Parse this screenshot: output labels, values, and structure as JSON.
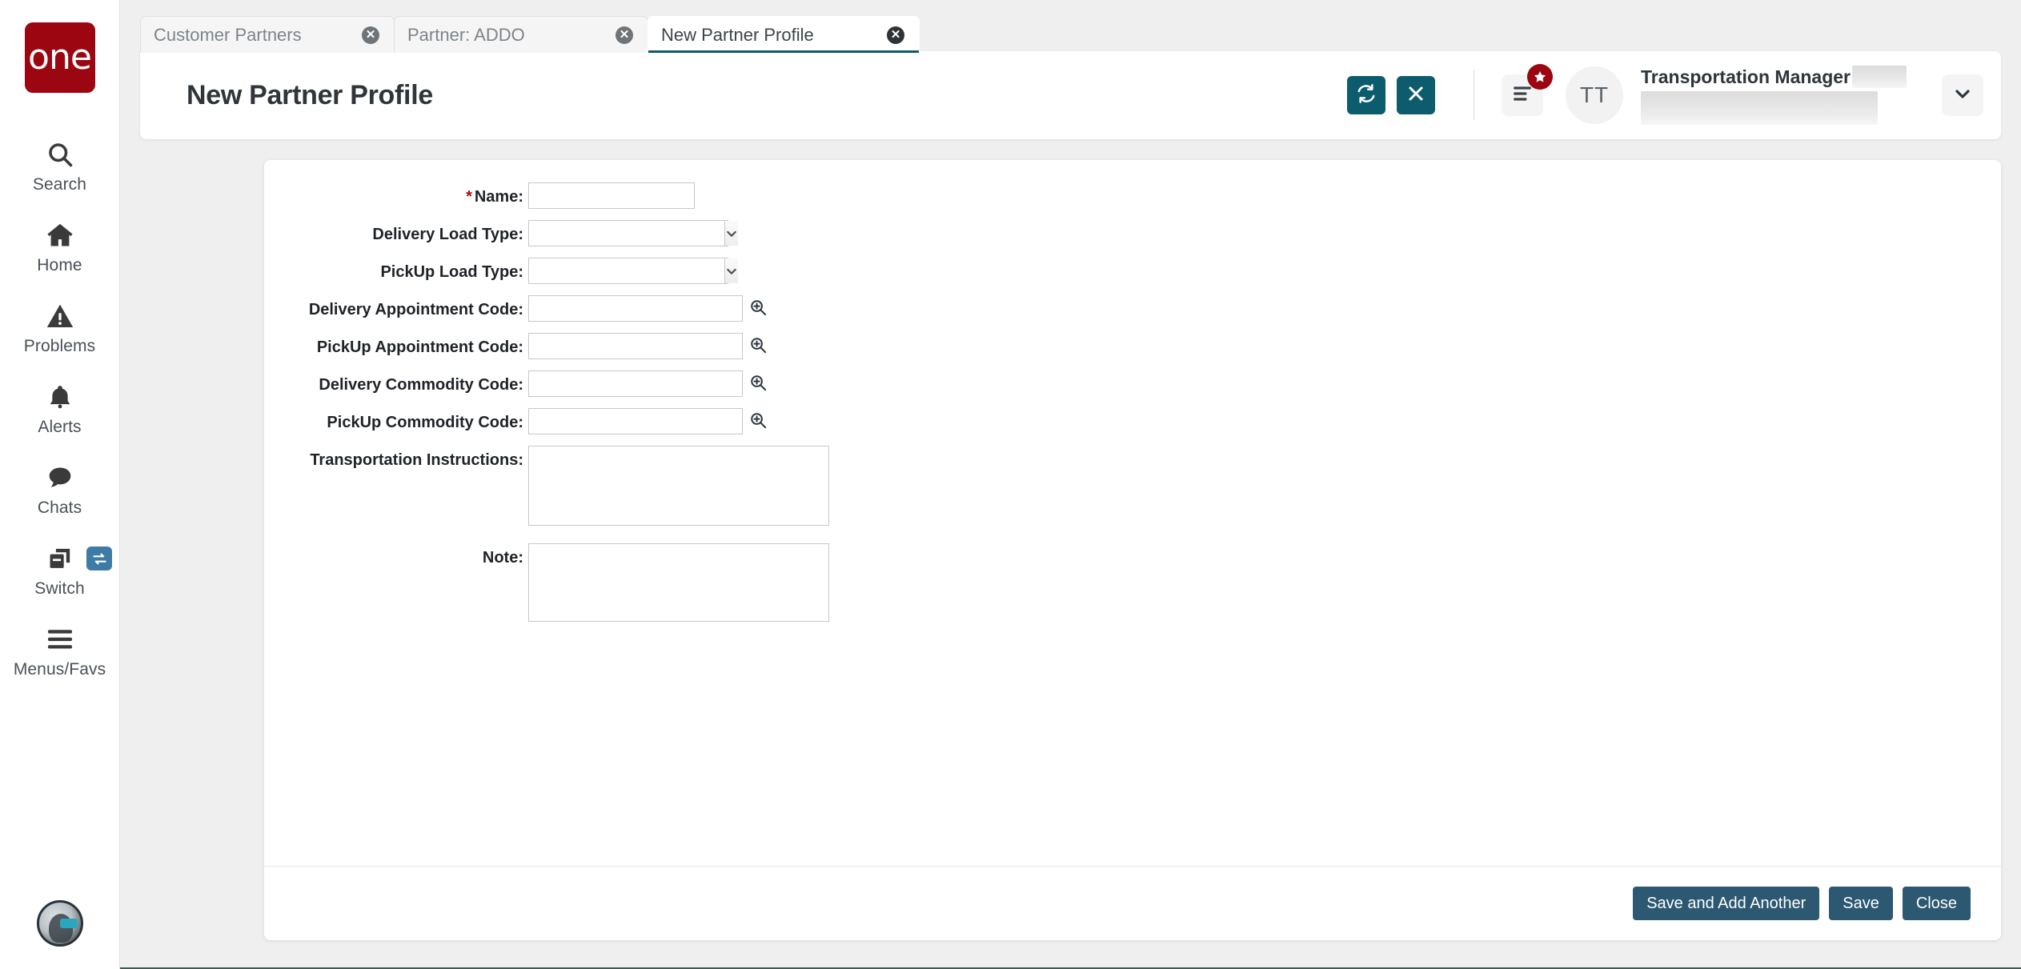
{
  "brand": {
    "logo_text": "one",
    "logo_color": "#9b0610"
  },
  "theme": {
    "accent_teal": "#0d5c6e",
    "button_navy": "#2c5871",
    "badge_red": "#9b0610",
    "required_red": "#b00a0a",
    "switch_blue": "#3e7ca6"
  },
  "sidebar": {
    "items": [
      {
        "label": "Search",
        "icon": "search-icon"
      },
      {
        "label": "Home",
        "icon": "home-icon"
      },
      {
        "label": "Problems",
        "icon": "warning-triangle-icon"
      },
      {
        "label": "Alerts",
        "icon": "bell-icon"
      },
      {
        "label": "Chats",
        "icon": "chat-bubble-icon"
      },
      {
        "label": "Switch",
        "icon": "switch-windows-icon"
      },
      {
        "label": "Menus/Favs",
        "icon": "hamburger-icon"
      }
    ],
    "assistant_avatar": "robot-assistant-icon"
  },
  "tabs": [
    {
      "label": "Customer Partners",
      "active": false
    },
    {
      "label": "Partner: ADDO",
      "active": false
    },
    {
      "label": "New Partner Profile",
      "active": true
    }
  ],
  "header": {
    "title": "New Partner Profile",
    "refresh_icon": "refresh-icon",
    "close_icon": "close-x-icon",
    "menu_icon": "menu-lines-icon",
    "menu_badge_icon": "star-icon",
    "avatar_initials": "TT",
    "user_role": "Transportation Manager",
    "user_name_redacted": "",
    "dropdown_icon": "chevron-down-icon"
  },
  "form": {
    "fields": [
      {
        "label": "Name:",
        "required": true,
        "type": "text",
        "value": "",
        "placeholder": "",
        "name": "name-field"
      },
      {
        "label": "Delivery Load Type:",
        "required": false,
        "type": "select",
        "value": "",
        "name": "delivery-load-type-select"
      },
      {
        "label": "PickUp Load Type:",
        "required": false,
        "type": "select",
        "value": "",
        "name": "pickup-load-type-select"
      },
      {
        "label": "Delivery Appointment Code:",
        "required": false,
        "type": "lookup",
        "value": "",
        "name": "delivery-appointment-code-field"
      },
      {
        "label": "PickUp Appointment Code:",
        "required": false,
        "type": "lookup",
        "value": "",
        "name": "pickup-appointment-code-field"
      },
      {
        "label": "Delivery Commodity Code:",
        "required": false,
        "type": "lookup",
        "value": "",
        "name": "delivery-commodity-code-field"
      },
      {
        "label": "PickUp Commodity Code:",
        "required": false,
        "type": "lookup",
        "value": "",
        "name": "pickup-commodity-code-field"
      },
      {
        "label": "Transportation Instructions:",
        "required": false,
        "type": "textarea",
        "value": "",
        "name": "transportation-instructions-textarea"
      },
      {
        "label": "Note:",
        "required": false,
        "type": "textarea",
        "value": "",
        "name": "note-textarea"
      }
    ]
  },
  "footer": {
    "save_and_add_another_label": "Save and Add Another",
    "save_label": "Save",
    "close_label": "Close"
  }
}
